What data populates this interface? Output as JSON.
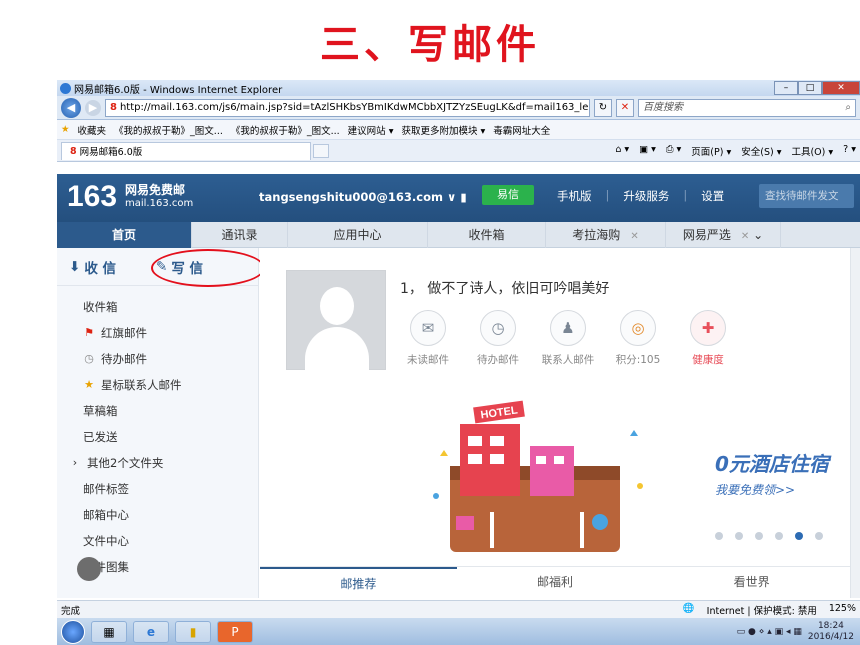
{
  "slide_title": "三、写邮件",
  "window": {
    "title": "网易邮箱6.0版 - Windows Internet Explorer",
    "url": "http://mail.163.com/js6/main.jsp?sid=tAzlSHKbsYBmIKdwMCbbXJTZYzSEugLK&df=mail163_le",
    "search_placeholder": "百度搜索",
    "favorites": [
      "收藏夹",
      "《我的叔叔于勒》_图文...",
      "《我的叔叔于勒》_图文...",
      "建议网站 ▾",
      "获取更多附加模块 ▾",
      "毒霸网址大全"
    ],
    "tab_title": "网易邮箱6.0版",
    "commands": [
      "页面(P) ▾",
      "安全(S) ▾",
      "工具(O) ▾"
    ]
  },
  "mail": {
    "logo_number": "163",
    "logo_title": "网易免费邮",
    "logo_domain": "mail.163.com",
    "account": "tangsengshitu000@163.com",
    "yixin": "易信",
    "header_links": [
      "手机版",
      "升级服务",
      "设置"
    ],
    "search_placeholder": "查找待邮件发文",
    "nav": [
      {
        "label": "首页",
        "closable": false
      },
      {
        "label": "通讯录",
        "closable": false
      },
      {
        "label": "应用中心",
        "closable": false
      },
      {
        "label": "收件箱",
        "closable": false
      },
      {
        "label": "考拉海购",
        "closable": true
      },
      {
        "label": "网易严选",
        "closable": true
      }
    ],
    "receive": "收 信",
    "compose": "写 信",
    "folders": [
      {
        "label": "收件箱",
        "icon": ""
      },
      {
        "label": "红旗邮件",
        "icon": "flag"
      },
      {
        "label": "待办邮件",
        "icon": "clock"
      },
      {
        "label": "星标联系人邮件",
        "icon": "star"
      },
      {
        "label": "草稿箱",
        "icon": ""
      },
      {
        "label": "已发送",
        "icon": ""
      },
      {
        "label": "其他2个文件夹",
        "icon": "arrow"
      },
      {
        "label": "邮件标签",
        "icon": ""
      },
      {
        "label": "邮箱中心",
        "icon": ""
      },
      {
        "label": "文件中心",
        "icon": ""
      },
      {
        "label": "邮件图集",
        "icon": ""
      }
    ],
    "greeting": "1， 做不了诗人，依旧可吟唱美好",
    "stats": [
      {
        "label": "未读邮件",
        "icon": "✉"
      },
      {
        "label": "待办邮件",
        "icon": "◷"
      },
      {
        "label": "联系人邮件",
        "icon": "👤"
      },
      {
        "label": "积分:105",
        "icon": "◎"
      },
      {
        "label": "健康度",
        "icon": "✚"
      }
    ],
    "banner_title": "0元酒店住宿",
    "banner_sub": "我要免费领>>",
    "hotel_sign": "HOTEL",
    "bottom_tabs": [
      "邮推荐",
      "邮福利",
      "看世界"
    ]
  },
  "status": {
    "left": "完成",
    "zone": "Internet | 保护模式: 禁用",
    "zoom": "125%",
    "time": "18:24",
    "date": "2016/4/12"
  }
}
